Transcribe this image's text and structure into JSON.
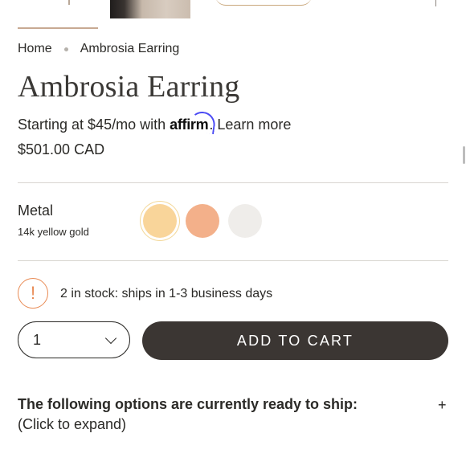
{
  "breadcrumb": {
    "home": "Home",
    "current": "Ambrosia Earring"
  },
  "product": {
    "title": "Ambrosia Earring",
    "financing_prefix": "Starting at $45/mo with",
    "affirm_brand": "affirm",
    "learn_more": ". Learn more",
    "price": "$501.00 CAD"
  },
  "metal": {
    "label": "Metal",
    "selected_value": "14k yellow gold",
    "swatches": [
      {
        "name": "yellow-gold",
        "color": "#f9d59a",
        "selected": true
      },
      {
        "name": "rose-gold",
        "color": "#f3b08a",
        "selected": false
      },
      {
        "name": "white-gold",
        "color": "#efedea",
        "selected": false
      }
    ]
  },
  "stock": {
    "icon": "!",
    "text": "2 in stock: ships in 1-3 business days"
  },
  "quantity": {
    "value": "1"
  },
  "add_to_cart": "ADD TO CART",
  "ready_to_ship": {
    "title": "The following options are currently ready to ship:",
    "subtitle": "(Click to expand)",
    "expand_icon": "+"
  },
  "colors": {
    "accent": "#e98b55",
    "button": "#3b3633",
    "affirm": "#4a4af4"
  }
}
